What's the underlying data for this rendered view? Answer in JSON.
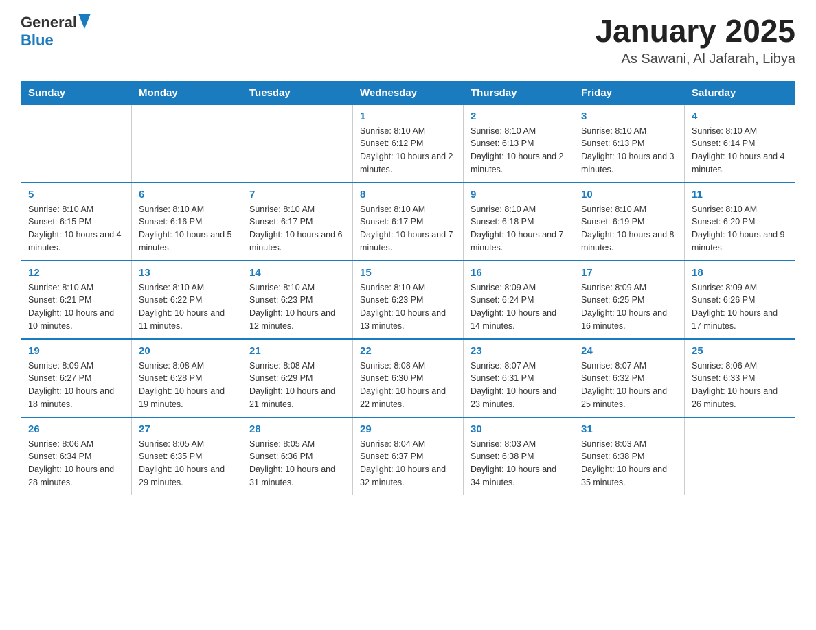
{
  "header": {
    "logo_general": "General",
    "logo_blue": "Blue",
    "month_title": "January 2025",
    "location": "As Sawani, Al Jafarah, Libya"
  },
  "days_of_week": [
    "Sunday",
    "Monday",
    "Tuesday",
    "Wednesday",
    "Thursday",
    "Friday",
    "Saturday"
  ],
  "weeks": [
    [
      {
        "day": "",
        "info": ""
      },
      {
        "day": "",
        "info": ""
      },
      {
        "day": "",
        "info": ""
      },
      {
        "day": "1",
        "info": "Sunrise: 8:10 AM\nSunset: 6:12 PM\nDaylight: 10 hours and 2 minutes."
      },
      {
        "day": "2",
        "info": "Sunrise: 8:10 AM\nSunset: 6:13 PM\nDaylight: 10 hours and 2 minutes."
      },
      {
        "day": "3",
        "info": "Sunrise: 8:10 AM\nSunset: 6:13 PM\nDaylight: 10 hours and 3 minutes."
      },
      {
        "day": "4",
        "info": "Sunrise: 8:10 AM\nSunset: 6:14 PM\nDaylight: 10 hours and 4 minutes."
      }
    ],
    [
      {
        "day": "5",
        "info": "Sunrise: 8:10 AM\nSunset: 6:15 PM\nDaylight: 10 hours and 4 minutes."
      },
      {
        "day": "6",
        "info": "Sunrise: 8:10 AM\nSunset: 6:16 PM\nDaylight: 10 hours and 5 minutes."
      },
      {
        "day": "7",
        "info": "Sunrise: 8:10 AM\nSunset: 6:17 PM\nDaylight: 10 hours and 6 minutes."
      },
      {
        "day": "8",
        "info": "Sunrise: 8:10 AM\nSunset: 6:17 PM\nDaylight: 10 hours and 7 minutes."
      },
      {
        "day": "9",
        "info": "Sunrise: 8:10 AM\nSunset: 6:18 PM\nDaylight: 10 hours and 7 minutes."
      },
      {
        "day": "10",
        "info": "Sunrise: 8:10 AM\nSunset: 6:19 PM\nDaylight: 10 hours and 8 minutes."
      },
      {
        "day": "11",
        "info": "Sunrise: 8:10 AM\nSunset: 6:20 PM\nDaylight: 10 hours and 9 minutes."
      }
    ],
    [
      {
        "day": "12",
        "info": "Sunrise: 8:10 AM\nSunset: 6:21 PM\nDaylight: 10 hours and 10 minutes."
      },
      {
        "day": "13",
        "info": "Sunrise: 8:10 AM\nSunset: 6:22 PM\nDaylight: 10 hours and 11 minutes."
      },
      {
        "day": "14",
        "info": "Sunrise: 8:10 AM\nSunset: 6:23 PM\nDaylight: 10 hours and 12 minutes."
      },
      {
        "day": "15",
        "info": "Sunrise: 8:10 AM\nSunset: 6:23 PM\nDaylight: 10 hours and 13 minutes."
      },
      {
        "day": "16",
        "info": "Sunrise: 8:09 AM\nSunset: 6:24 PM\nDaylight: 10 hours and 14 minutes."
      },
      {
        "day": "17",
        "info": "Sunrise: 8:09 AM\nSunset: 6:25 PM\nDaylight: 10 hours and 16 minutes."
      },
      {
        "day": "18",
        "info": "Sunrise: 8:09 AM\nSunset: 6:26 PM\nDaylight: 10 hours and 17 minutes."
      }
    ],
    [
      {
        "day": "19",
        "info": "Sunrise: 8:09 AM\nSunset: 6:27 PM\nDaylight: 10 hours and 18 minutes."
      },
      {
        "day": "20",
        "info": "Sunrise: 8:08 AM\nSunset: 6:28 PM\nDaylight: 10 hours and 19 minutes."
      },
      {
        "day": "21",
        "info": "Sunrise: 8:08 AM\nSunset: 6:29 PM\nDaylight: 10 hours and 21 minutes."
      },
      {
        "day": "22",
        "info": "Sunrise: 8:08 AM\nSunset: 6:30 PM\nDaylight: 10 hours and 22 minutes."
      },
      {
        "day": "23",
        "info": "Sunrise: 8:07 AM\nSunset: 6:31 PM\nDaylight: 10 hours and 23 minutes."
      },
      {
        "day": "24",
        "info": "Sunrise: 8:07 AM\nSunset: 6:32 PM\nDaylight: 10 hours and 25 minutes."
      },
      {
        "day": "25",
        "info": "Sunrise: 8:06 AM\nSunset: 6:33 PM\nDaylight: 10 hours and 26 minutes."
      }
    ],
    [
      {
        "day": "26",
        "info": "Sunrise: 8:06 AM\nSunset: 6:34 PM\nDaylight: 10 hours and 28 minutes."
      },
      {
        "day": "27",
        "info": "Sunrise: 8:05 AM\nSunset: 6:35 PM\nDaylight: 10 hours and 29 minutes."
      },
      {
        "day": "28",
        "info": "Sunrise: 8:05 AM\nSunset: 6:36 PM\nDaylight: 10 hours and 31 minutes."
      },
      {
        "day": "29",
        "info": "Sunrise: 8:04 AM\nSunset: 6:37 PM\nDaylight: 10 hours and 32 minutes."
      },
      {
        "day": "30",
        "info": "Sunrise: 8:03 AM\nSunset: 6:38 PM\nDaylight: 10 hours and 34 minutes."
      },
      {
        "day": "31",
        "info": "Sunrise: 8:03 AM\nSunset: 6:38 PM\nDaylight: 10 hours and 35 minutes."
      },
      {
        "day": "",
        "info": ""
      }
    ]
  ]
}
